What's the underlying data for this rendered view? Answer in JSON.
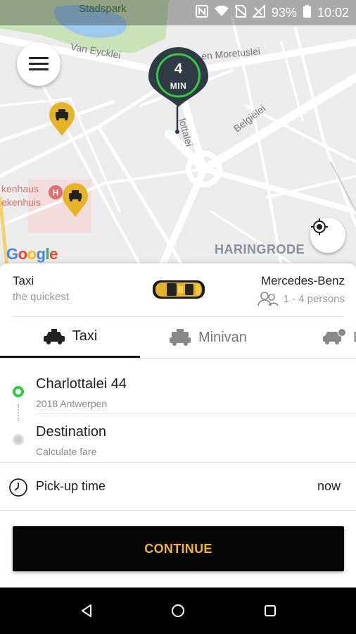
{
  "status_bar": {
    "map_top_label": "Stadspark",
    "battery": "93%",
    "time": "10:02",
    "icons": [
      "nfc-icon",
      "wifi-icon",
      "no-sim-icon",
      "signal-icon",
      "battery-icon"
    ]
  },
  "map": {
    "street_labels": [
      "Van Eycklei",
      "en Moretuslei",
      "Belgiëlei",
      "lottalei"
    ],
    "poi_label_1": "kenhaus",
    "poi_label_2": "ekenhuis",
    "district": "HARINGRODE",
    "attribution": "Google",
    "pickup_eta": {
      "value": "4",
      "unit": "MIN"
    },
    "icons": [
      "menu-icon",
      "my-location-icon",
      "taxi-marker-icon",
      "hospital-icon"
    ]
  },
  "vehicle_info": {
    "title": "Taxi",
    "subtitle": "the quickest",
    "model": "Mercedes-Benz",
    "capacity": "1 - 4 persons"
  },
  "tabs": [
    {
      "label": "Taxi",
      "selected": true
    },
    {
      "label": "Minivan",
      "selected": false
    },
    {
      "label": "B",
      "selected": false
    }
  ],
  "pickup": {
    "title": "Charlottalei 44",
    "subtitle": "2018 Antwerpen"
  },
  "destination": {
    "title": "Destination",
    "subtitle": "Calculate fare"
  },
  "pickup_time": {
    "label": "Pick-up time",
    "value": "now"
  },
  "continue_label": "CONTINUE",
  "colors": {
    "accent": "#f0b62a",
    "marker_yellow": "#e6b423",
    "pickup_dot": "#2ecc40",
    "pin_dark": "#2f3a45"
  }
}
